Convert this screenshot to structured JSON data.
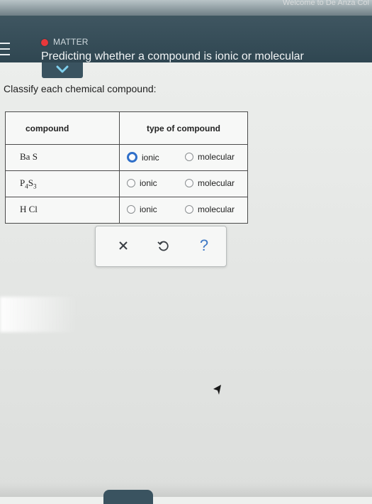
{
  "header": {
    "welcome_text": "Welcome to De Anza Col",
    "topic": "MATTER",
    "title": "Predicting whether a compound is ionic or molecular",
    "status_color": "#e8383b",
    "accent_color": "#2f6fc9"
  },
  "icons": {
    "menu": "hamburger-menu-icon",
    "collapse": "chevron-down-icon",
    "clear": "x-icon",
    "undo": "undo-icon",
    "help": "question-mark-icon"
  },
  "question": {
    "prompt": "Classify each chemical compound:"
  },
  "table": {
    "headers": [
      "compound",
      "type of compound"
    ],
    "option_labels": [
      "ionic",
      "molecular"
    ],
    "rows": [
      {
        "formula_parts": [
          "Ba",
          "",
          "S",
          ""
        ],
        "selected": "none",
        "focused": "ionic"
      },
      {
        "formula_parts": [
          "P",
          "4",
          "S",
          "3"
        ],
        "selected": "none",
        "focused": ""
      },
      {
        "formula_parts": [
          "H",
          "",
          "Cl",
          ""
        ],
        "selected": "none",
        "focused": ""
      }
    ]
  },
  "toolbar": {
    "help_label": "?"
  }
}
